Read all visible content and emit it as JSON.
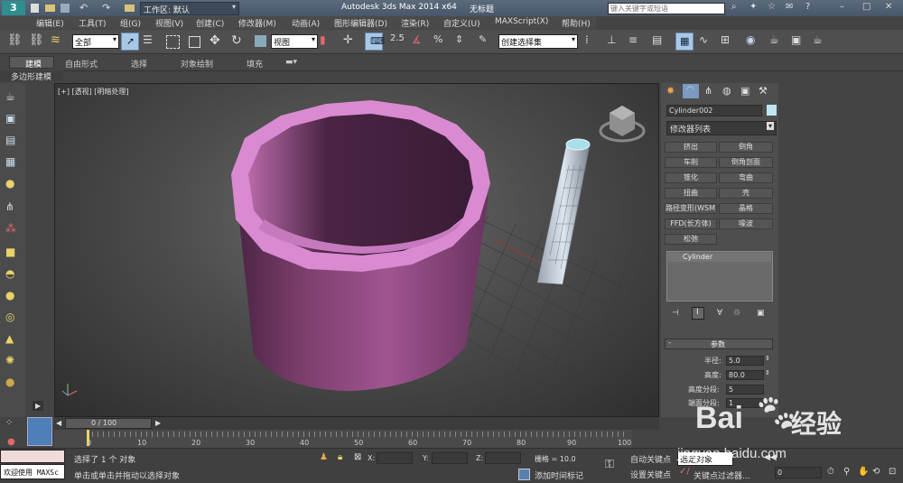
{
  "titlebar": {
    "workspace_label": "工作区: 默认",
    "app_title": "Autodesk 3ds Max  2014 x64",
    "doc_title": "无标题",
    "search_placeholder": "键入关键字或短语"
  },
  "menu": [
    "编辑(E)",
    "工具(T)",
    "组(G)",
    "视图(V)",
    "创建(C)",
    "修改器(M)",
    "动画(A)",
    "图形编辑器(D)",
    "渲染(R)",
    "自定义(U)",
    "MAXScript(X)",
    "帮助(H)"
  ],
  "toolbar": {
    "selection_filter": "全部",
    "ref_coord": "视图",
    "snap_value": "2.5",
    "named_selection": "创建选择集"
  },
  "ribbon": {
    "tabs": [
      "建模",
      "自由形式",
      "选择",
      "对象绘制",
      "填充"
    ],
    "sub_label": "多边形建模"
  },
  "viewport": {
    "label": "[+] [透视] [明暗处理]"
  },
  "command_panel": {
    "object_name": "Cylinder002",
    "modifier_list": "修改器列表",
    "modifier_buttons": [
      [
        "挤出",
        "倒角"
      ],
      [
        "车削",
        "倒角剖面"
      ],
      [
        "锥化",
        "弯曲"
      ],
      [
        "扭曲",
        "壳"
      ],
      [
        "路径变形(WSM)",
        "晶格"
      ],
      [
        "FFD(长方体)",
        "噪波"
      ],
      [
        "松弛",
        ""
      ]
    ],
    "stack_item": "Cylinder",
    "rollout_title": "参数",
    "params": [
      {
        "label": "半径:",
        "value": "5.0"
      },
      {
        "label": "高度:",
        "value": "80.0"
      },
      {
        "label": "高度分段:",
        "value": "5"
      },
      {
        "label": "端面分段:",
        "value": "1"
      }
    ]
  },
  "timeline": {
    "frame_label": "0 / 100",
    "ticks": [
      "0",
      "10",
      "20",
      "30",
      "40",
      "50",
      "60",
      "70",
      "80",
      "90",
      "100"
    ]
  },
  "status": {
    "welcome": "欢迎使用 MAXSc",
    "selected": "选择了 1 个 对象",
    "prompt": "单击或单击并拖动以选择对象",
    "x_label": "X:",
    "y_label": "Y:",
    "z_label": "Z:",
    "grid": "栅格 = 10.0",
    "add_time_tag": "添加时间标记",
    "auto_key": "自动关键点",
    "set_key": "设置关键点",
    "selection_set": "选定对象",
    "key_filters": "关键点过滤器...",
    "frame_value": "0"
  },
  "watermark": {
    "brand": "Bai",
    "brand_cn": "经验",
    "url": "jingyan.baidu.com"
  },
  "colors": {
    "cylinder_body": "#7a3d6a",
    "cylinder_rim": "#d98ad0",
    "active_button": "#a8c8e8",
    "stack_bg": "#6a6a6a"
  }
}
